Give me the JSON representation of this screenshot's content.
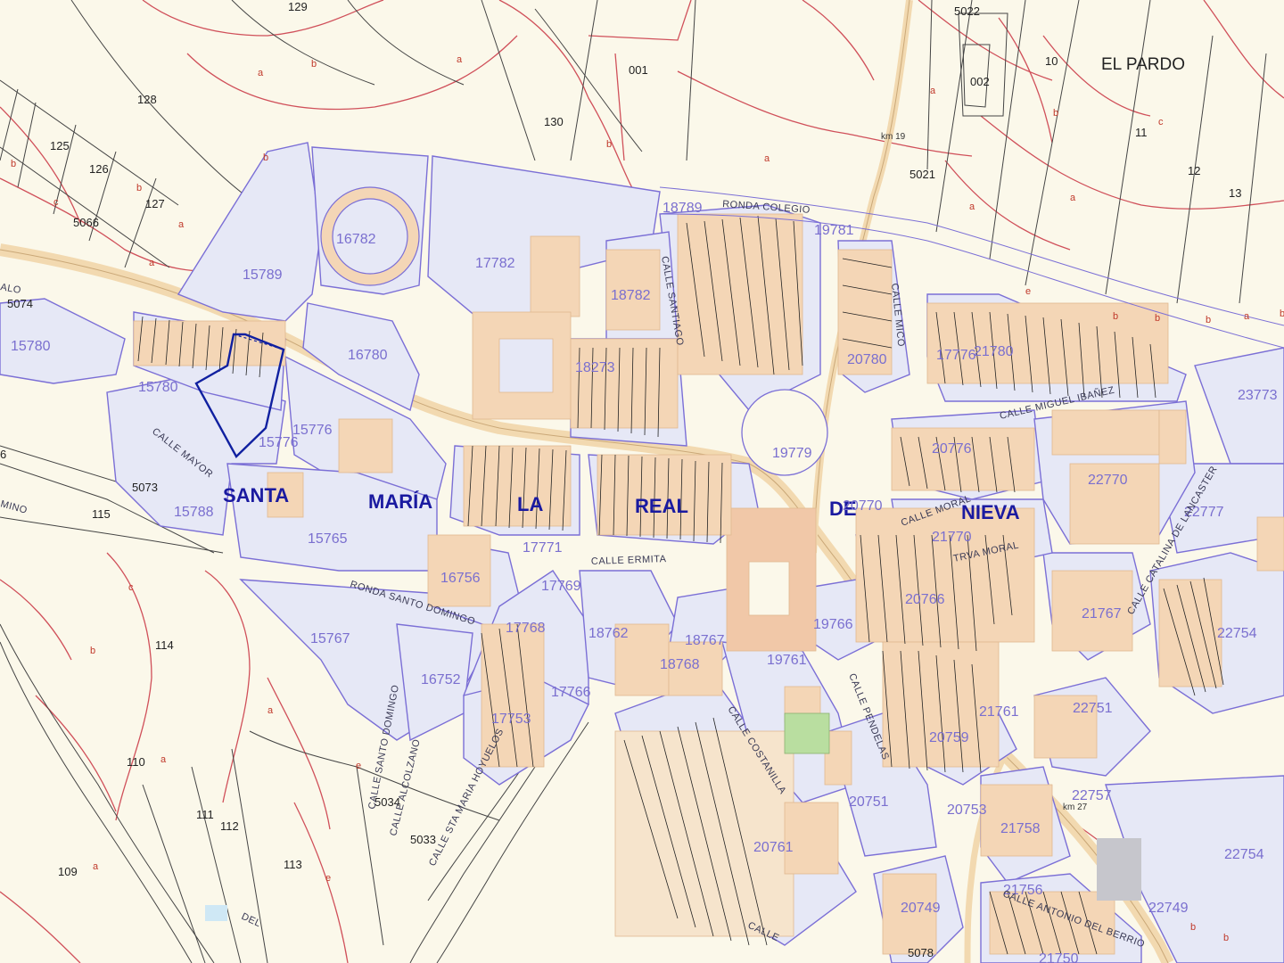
{
  "map": {
    "town_name_parts": [
      "SANTA",
      "MARÍA",
      "LA",
      "REAL",
      "DE",
      "NIEVA"
    ],
    "place_names": [
      "EL PARDO"
    ],
    "urban_parcels": [
      "15789",
      "16782",
      "17782",
      "18789",
      "19781",
      "18782",
      "18273",
      "17776",
      "15780",
      "15780",
      "15776",
      "16780",
      "19779",
      "20780",
      "21780",
      "23773",
      "22770",
      "20776",
      "20770",
      "21770",
      "22777",
      "15788",
      "15765",
      "17771",
      "17769",
      "16756",
      "17768",
      "18762",
      "18767",
      "18768",
      "19766",
      "19761",
      "20766",
      "21767",
      "22754",
      "22754",
      "15767",
      "16752",
      "17753",
      "17766",
      "21761",
      "20759",
      "22751",
      "22757",
      "20751",
      "20753",
      "21758",
      "21756",
      "20749",
      "22749",
      "15776",
      "20761",
      "21750"
    ],
    "rural_parcels": [
      "129",
      "128",
      "125",
      "126",
      "127",
      "5066",
      "5074",
      "5073",
      "115",
      "114",
      "110",
      "111",
      "112",
      "113",
      "109",
      "130",
      "001",
      "5022",
      "002",
      "10",
      "11",
      "12",
      "13",
      "5021",
      "5034",
      "5033",
      "6",
      "5078"
    ],
    "subparcel_letters": [
      "a",
      "b",
      "a",
      "b",
      "c",
      "a",
      "b",
      "a",
      "b",
      "a",
      "b",
      "a",
      "b",
      "c",
      "a",
      "a",
      "e",
      "b",
      "b",
      "b",
      "a",
      "b",
      "a",
      "b",
      "a",
      "e",
      "a",
      "e",
      "b",
      "b",
      "c"
    ],
    "streets": [
      "RONDA COLEGIO",
      "CALLE SANTIAGO",
      "CALLE MAYOR",
      "CALLE ERMITA",
      "RONDA SANTO DOMINGO",
      "CALLE SANTO DOMINGO",
      "CALLE ALCOLZANO",
      "CALLE STA MARIA HOYUELOS",
      "CALLE MIGUEL IBAÑEZ",
      "CALLE MORAL",
      "TRVA MORAL",
      "CALLE CATALINA DE LANCASTER",
      "CALLE MICO",
      "CALLE PENDELAS",
      "CALLE COSTANILLA",
      "CALLE ANTONIO DEL BERRIO",
      "CALLE",
      "DEL",
      "MINO",
      "ALO"
    ],
    "km_markers": [
      "km 19",
      "km 27"
    ]
  },
  "colors": {
    "background": "#fbf8ea",
    "urban_fill": "#e6e8f6",
    "parcel_line": "#7b6fd6",
    "building_fill": "#f4d6b6",
    "rural_line": "#444444",
    "boundary_red": "#d0505a",
    "road_fill": "#f2d9b0",
    "selected_parcel": "#1020a0",
    "green_area": "#b9dea0"
  }
}
